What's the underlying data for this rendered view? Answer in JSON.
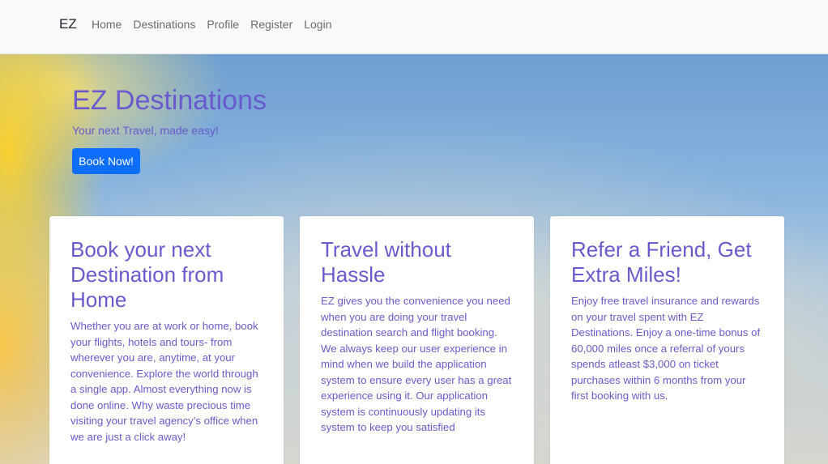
{
  "navbar": {
    "brand": "EZ",
    "links": [
      "Home",
      "Destinations",
      "Profile",
      "Register",
      "Login"
    ]
  },
  "hero": {
    "title": "EZ Destinations",
    "subtitle": "Your next Travel, made easy!",
    "cta_label": "Book Now!"
  },
  "cards": [
    {
      "title": "Book your next Destination from Home",
      "text": "Whether you are at work or home, book your flights, hotels and tours- from wherever you are, anytime, at your convenience. Explore the world through a single app. Almost everything now is done online. Why waste precious time visiting your travel agency’s office when we are just a click away!"
    },
    {
      "title": "Travel without Hassle",
      "text": "EZ gives you the convenience you need when you are doing your travel destination search and flight booking. We always keep our user experience in mind when we build the application system to ensure every user has a great experience using it. Our application system is continuously updating its system to keep you satisfied"
    },
    {
      "title": "Refer a Friend, Get Extra Miles!",
      "text": "Enjoy free travel insurance and rewards on your travel spent with EZ Destinations. Enjoy a one-time bonus of 60,000 miles once a referral of yours spends atleast $3,000 on ticket purchases within 6 months from your first booking with us."
    }
  ],
  "colors": {
    "accent_text": "#6a5acd",
    "button": "#0d6efd",
    "navbar_bg": "#f8f9fa"
  }
}
